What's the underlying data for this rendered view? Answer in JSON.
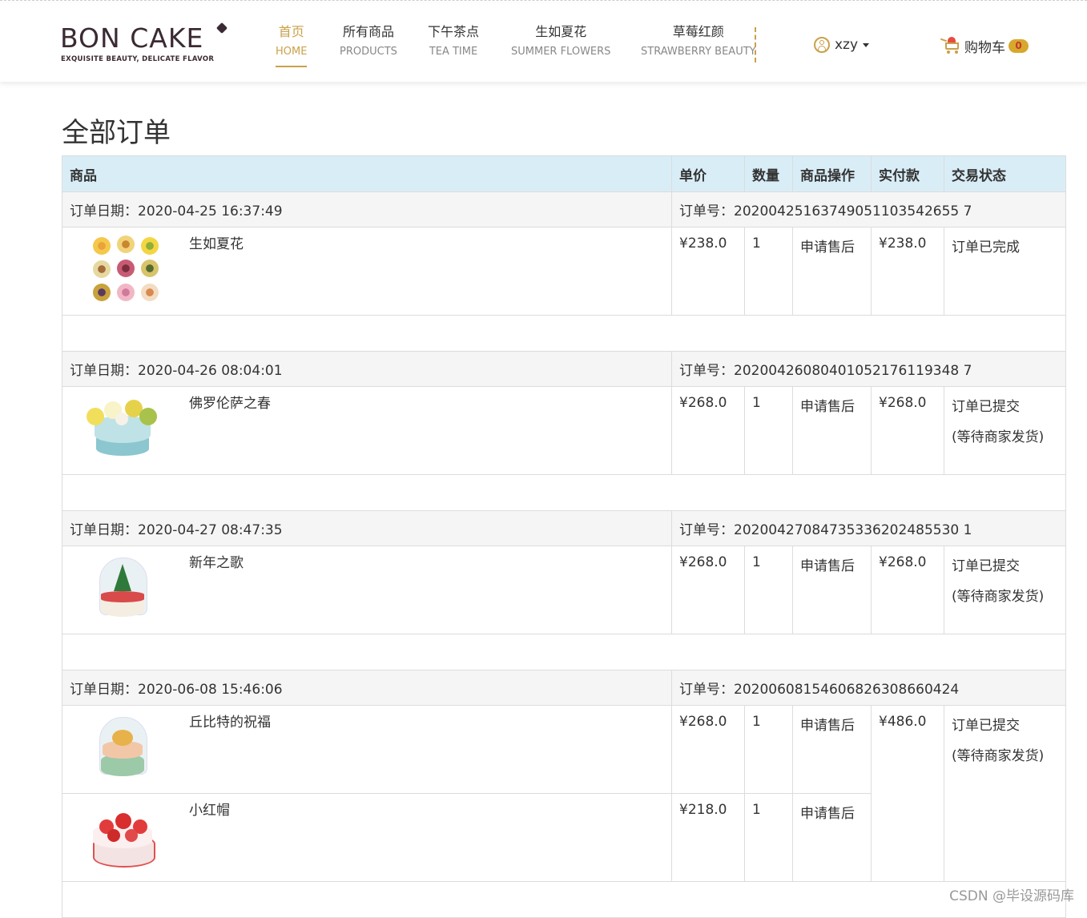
{
  "brand": {
    "name": "BON CAKE",
    "tagline": "EXQUISITE BEAUTY, DELICATE FLAVOR"
  },
  "nav": [
    {
      "cn": "首页",
      "en": "HOME",
      "active": true
    },
    {
      "cn": "所有商品",
      "en": "PRODUCTS",
      "active": false
    },
    {
      "cn": "下午茶点",
      "en": "TEA TIME",
      "active": false
    },
    {
      "cn": "生如夏花",
      "en": "SUMMER FLOWERS",
      "active": false
    },
    {
      "cn": "草莓红颜",
      "en": "STRAWBERRY BEAUTY",
      "active": false
    }
  ],
  "user": {
    "name": "xzy"
  },
  "cart": {
    "label": "购物车",
    "count": "0"
  },
  "page_title": "全部订单",
  "table_headers": {
    "product": "商品",
    "unit_price": "单价",
    "quantity": "数量",
    "action": "商品操作",
    "paid": "实付款",
    "status": "交易状态"
  },
  "orders": [
    {
      "date_label": "订单日期：2020-04-25 16:37:49",
      "number_label": "订单号：20200425163749051103542655 7",
      "items": [
        {
          "name": "生如夏花",
          "price": "¥238.0",
          "qty": "1",
          "action": "申请售后"
        }
      ],
      "paid": "¥238.0",
      "status_line1": "订单已完成",
      "status_line2": ""
    },
    {
      "date_label": "订单日期：2020-04-26 08:04:01",
      "number_label": "订单号：20200426080401052176119348 7",
      "items": [
        {
          "name": "佛罗伦萨之春",
          "price": "¥268.0",
          "qty": "1",
          "action": "申请售后"
        }
      ],
      "paid": "¥268.0",
      "status_line1": "订单已提交",
      "status_line2": "(等待商家发货)"
    },
    {
      "date_label": "订单日期：2020-04-27 08:47:35",
      "number_label": "订单号：20200427084735336202485530 1",
      "items": [
        {
          "name": "新年之歌",
          "price": "¥268.0",
          "qty": "1",
          "action": "申请售后"
        }
      ],
      "paid": "¥268.0",
      "status_line1": "订单已提交",
      "status_line2": "(等待商家发货)"
    },
    {
      "date_label": "订单日期：2020-06-08 15:46:06",
      "number_label": "订单号：20200608154606826308660424",
      "items": [
        {
          "name": "丘比特的祝福",
          "price": "¥268.0",
          "qty": "1",
          "action": "申请售后"
        },
        {
          "name": "小红帽",
          "price": "¥218.0",
          "qty": "1",
          "action": "申请售后"
        }
      ],
      "paid": "¥486.0",
      "status_line1": "订单已提交",
      "status_line2": "(等待商家发货)"
    }
  ],
  "watermark": "CSDN @毕设源码库"
}
